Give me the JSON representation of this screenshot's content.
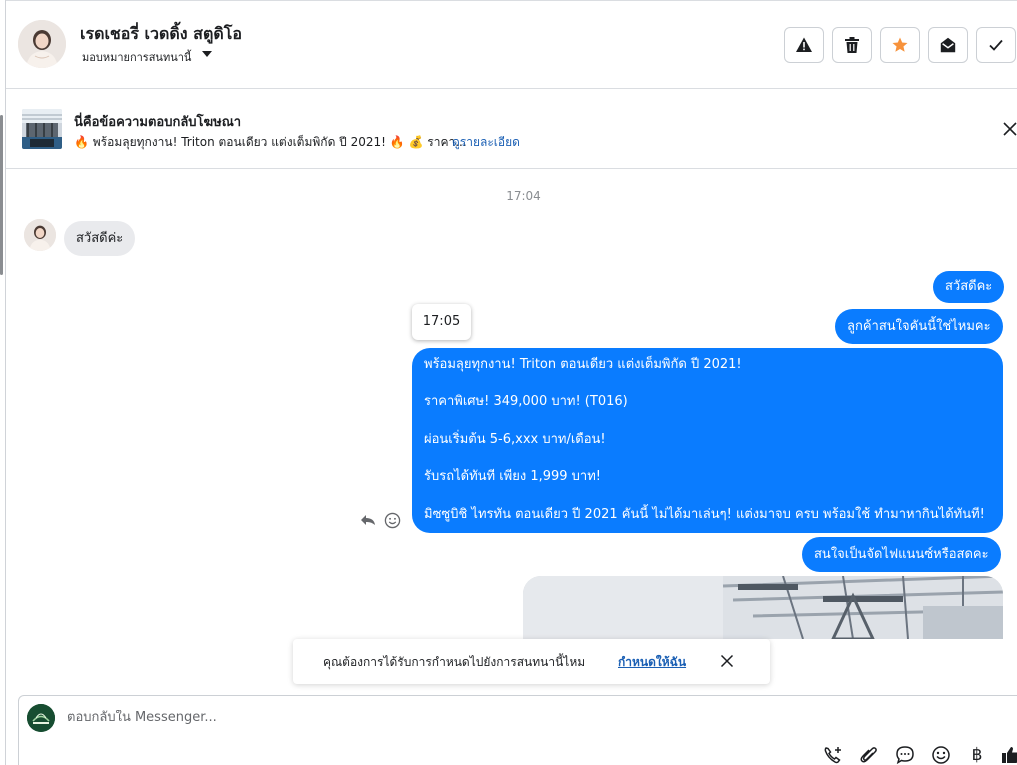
{
  "header": {
    "contact_name": "เรดเชอรี่ เวดดิ้ง สตูดิโอ",
    "assign_label": "มอบหมายการสนทนานี้",
    "actions": [
      {
        "name": "report-icon",
        "label": "alert"
      },
      {
        "name": "trash-icon",
        "label": "delete"
      },
      {
        "name": "star-icon",
        "label": "star",
        "color": "#f7923b"
      },
      {
        "name": "mark-unread-icon",
        "label": "envelope-open"
      },
      {
        "name": "checkmark-icon",
        "label": "done"
      }
    ]
  },
  "ad": {
    "title": "นี่คือข้อความตอบกลับโฆษณา",
    "description": "🔥 พร้อมลุยทุกงาน! Triton ตอนเดียว แต่งเต็มพิกัด ปี 2021! 🔥 💰 ราคา...",
    "details_link": "ดูรายละเอียด"
  },
  "conversation": {
    "timestamp": "17:04",
    "incoming": [
      {
        "text": "สวัสดีค่ะ"
      }
    ],
    "outgoing": [
      {
        "text": "สวัสดีคะ"
      },
      {
        "text": "ลูกค้าสนใจคันนี้ใช่ไหมคะ"
      }
    ],
    "hover_time": "17:05",
    "long_message": [
      "พร้อมลุยทุกงาน! Triton ตอนเดียว แต่งเต็มพิกัด ปี 2021!",
      "ราคาพิเศษ! 349,000 บาท! (T016)",
      "ผ่อนเริ่มต้น 5-6,xxx บาท/เดือน!",
      "รับรถได้ทันที เพียง 1,999 บาท!",
      "มิซซูบิชิ ไทรทัน ตอนเดียว ปี 2021 คันนี้ ไม่ได้มาเล่นๆ! แต่งมาจบ ครบ พร้อมใช้ ทำมาหากินได้ทันที!"
    ],
    "followup": "สนใจเป็นจัดไฟแนนซ์หรือสดคะ"
  },
  "toast": {
    "text": "คุณต้องการได้รับการกำหนดไปยังการสนทนานี้ไหม",
    "link": "กำหนดให้ฉัน"
  },
  "composer": {
    "placeholder": "ตอบกลับใน Messenger...",
    "currency_symbol": "฿"
  },
  "colors": {
    "outgoing_bubble": "#0a7cff",
    "incoming_bubble": "#e9eaed",
    "link": "#1a5fb4",
    "star": "#f7923b"
  }
}
